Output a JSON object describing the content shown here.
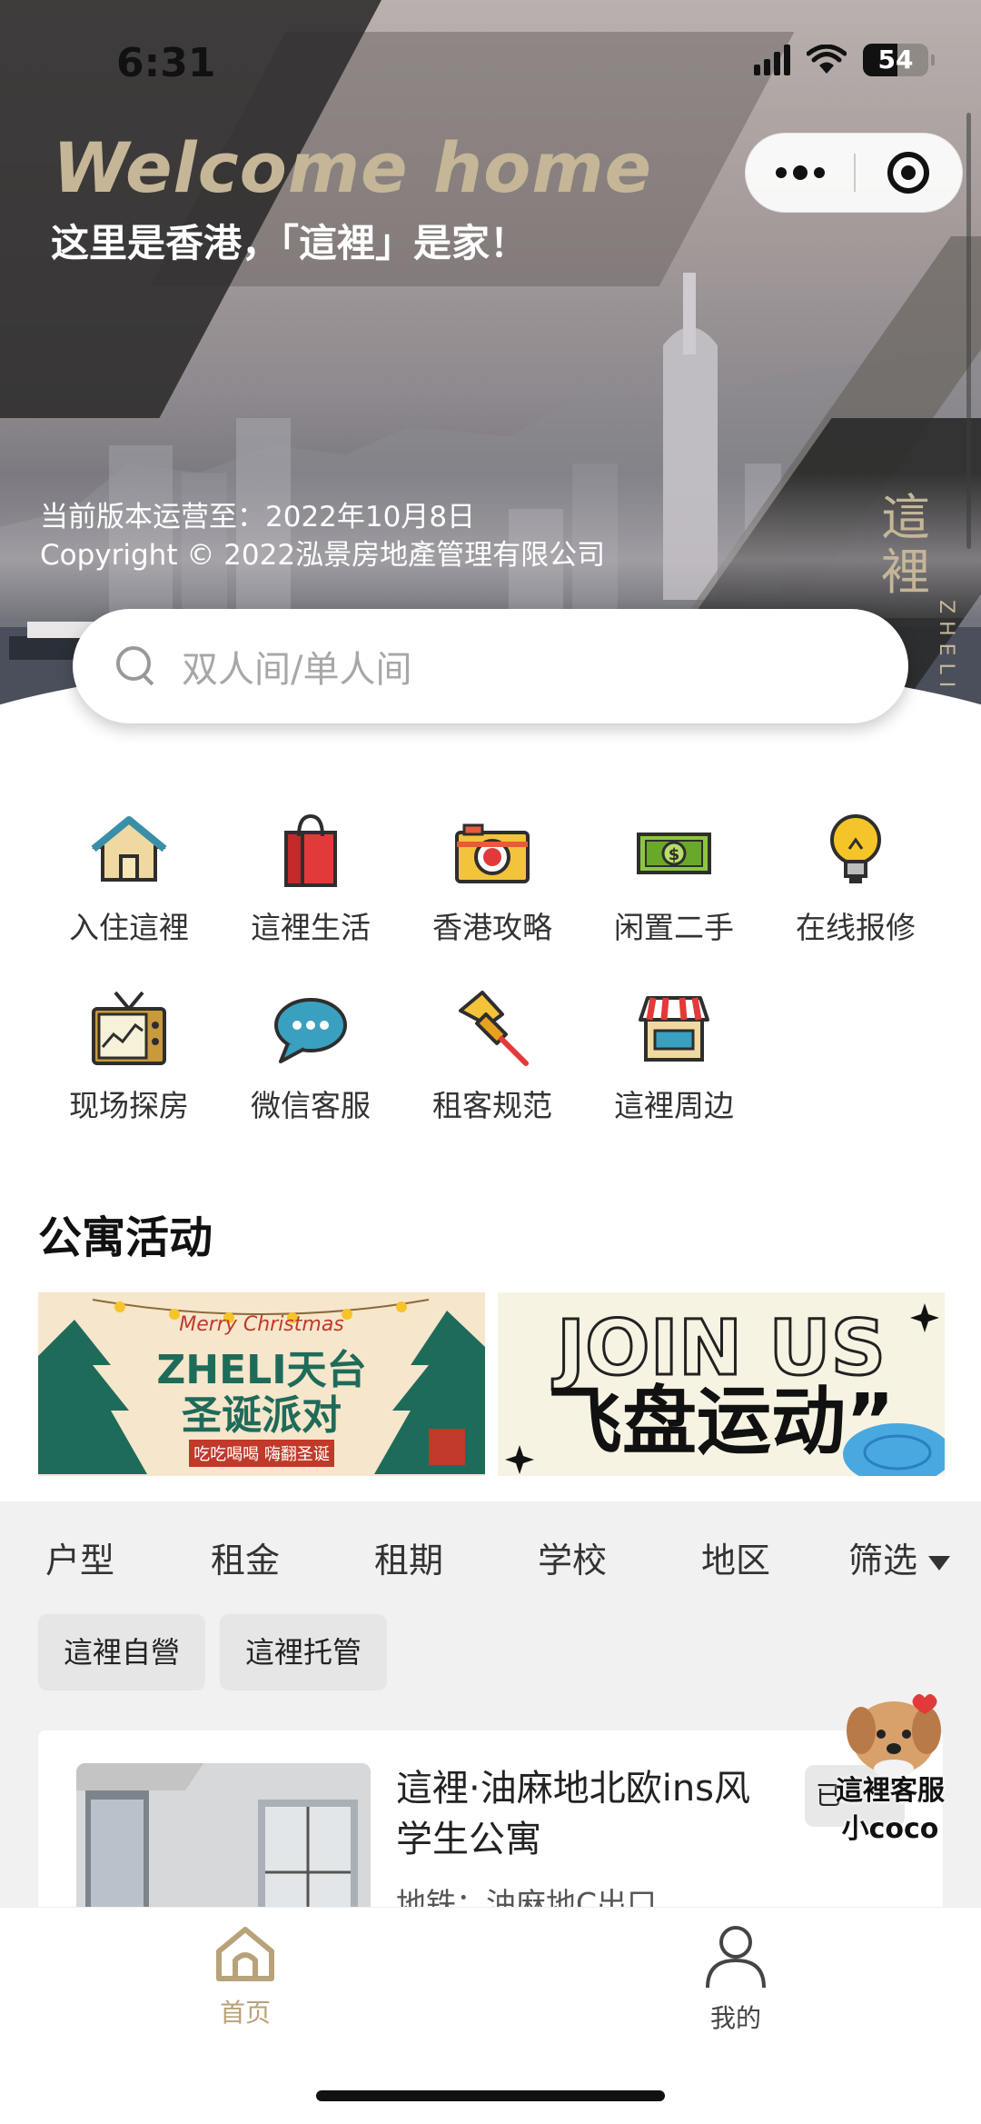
{
  "status_bar": {
    "time": "6:31",
    "battery": "54"
  },
  "hero": {
    "welcome": "Welcome home",
    "subtitle": "这里是香港，「這裡」是家！",
    "operating_until": "当前版本运营至：2022年10月8日",
    "copyright": "Copyright © 2022泓景房地產管理有限公司",
    "brand_vertical": "這裡",
    "brand_latin": "ZHELI"
  },
  "search": {
    "placeholder": "双人间/单人间"
  },
  "menu": [
    {
      "label": "入住這裡",
      "icon": "house-icon"
    },
    {
      "label": "這裡生活",
      "icon": "shopping-bag-icon"
    },
    {
      "label": "香港攻略",
      "icon": "camera-icon"
    },
    {
      "label": "闲置二手",
      "icon": "money-icon"
    },
    {
      "label": "在线报修",
      "icon": "lightbulb-icon"
    },
    {
      "label": "现场探房",
      "icon": "tv-icon"
    },
    {
      "label": "微信客服",
      "icon": "chat-bubble-icon"
    },
    {
      "label": "租客规范",
      "icon": "pushpin-icon"
    },
    {
      "label": "這裡周边",
      "icon": "storefront-icon"
    }
  ],
  "activities": {
    "title": "公寓活动",
    "banners": [
      {
        "line1": "Merry Christmas",
        "line2": "ZHELI天台",
        "line3": "圣诞派对",
        "line4": "吃吃喝喝 嗨翻圣诞"
      },
      {
        "line1": "JOIN US",
        "line2": "飞盘运动”"
      }
    ]
  },
  "filters": [
    "户型",
    "租金",
    "租期",
    "学校",
    "地区",
    "筛选"
  ],
  "tags": [
    "這裡自營",
    "這裡托管"
  ],
  "listing": {
    "title": "這裡·油麻地北欧ins风学生公寓",
    "subtitle": "地铁：油麻地C出口",
    "badge": "已"
  },
  "customer_service": {
    "line1": "這裡客服",
    "line2": "小coco"
  },
  "tabbar": [
    {
      "label": "首页",
      "icon": "home-icon",
      "active": true
    },
    {
      "label": "我的",
      "icon": "person-icon",
      "active": false
    }
  ],
  "colors": {
    "accent_gold": "#b8a27a",
    "text_dark": "#222222",
    "tag_bg": "#e6e6e6"
  }
}
